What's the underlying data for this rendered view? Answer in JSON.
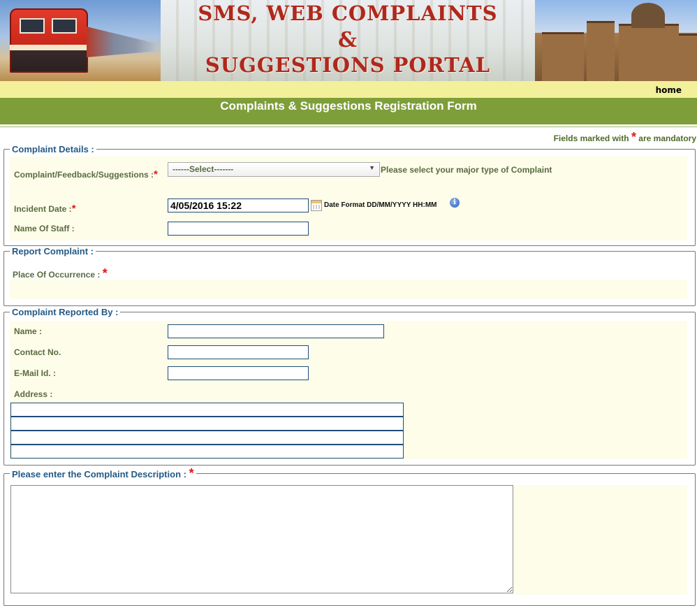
{
  "banner": {
    "title_line1": "SMS, WEB COMPLAINTS",
    "title_line2": "&",
    "title_line3": "SUGGESTIONS PORTAL"
  },
  "nav": {
    "home_label": "home"
  },
  "form_title": "Complaints & Suggestions Registration Form",
  "mandatory_note": {
    "prefix": "Fields marked with",
    "star": "*",
    "suffix": "are mandatory"
  },
  "complaint_details": {
    "legend": "Complaint Details :",
    "type_label": "Complaint/Feedback/Suggestions :",
    "type_selected": "------Select-------",
    "type_hint": "Please select your major type of Complaint",
    "incident_date_label": "Incident Date :",
    "incident_date_value": "4/05/2016 15:22",
    "date_format_hint": "Date Format DD/MM/YYYY HH:MM",
    "staff_label": "Name Of Staff :",
    "staff_value": ""
  },
  "report_complaint": {
    "legend": "Report Complaint :",
    "place_label": "Place Of Occurrence :"
  },
  "reported_by": {
    "legend": "Complaint Reported By :",
    "name_label": "Name :",
    "contact_label": "Contact No.",
    "email_label": "E-Mail Id. :",
    "address_label": "Address :"
  },
  "description": {
    "legend": "Please enter the Complaint Description :"
  },
  "colors": {
    "title_bar": "#7e9e3a",
    "nav_strip": "#f2f09a",
    "legend_text": "#245a86",
    "label_text": "#5a6b40",
    "mandatory_star": "#e01818",
    "banner_title": "#b0281d"
  }
}
